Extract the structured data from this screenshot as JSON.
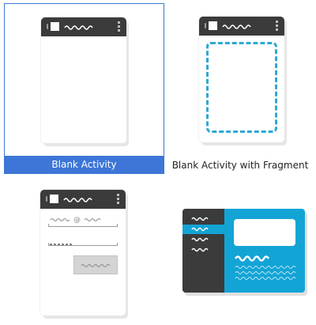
{
  "templates": [
    {
      "id": "blank-activity",
      "label": "Blank Activity",
      "selected": true
    },
    {
      "id": "blank-activity-with-fragment",
      "label": "Blank Activity with Fragment",
      "selected": false
    },
    {
      "id": "login-activity",
      "label": "",
      "selected": false
    },
    {
      "id": "master-detail-flow",
      "label": "",
      "selected": false
    }
  ],
  "icons": {
    "phone_menu": "three-dot-menu-icon",
    "email_at": "@"
  },
  "colors": {
    "selection": "#3d76d6",
    "accent_blue": "#13a4d6",
    "dark_bar": "#3b3b3b"
  }
}
